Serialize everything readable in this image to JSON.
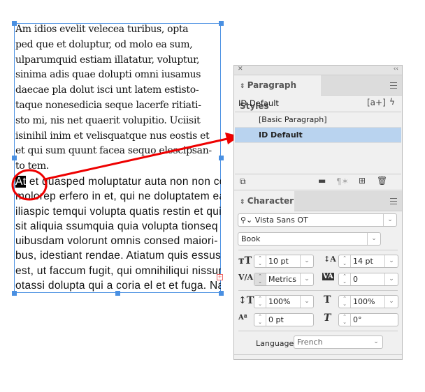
{
  "text_frame": {
    "serif_lines": [
      "Am idios evelit velecea turibus, opta",
      "ped que et doluptur, od molo ea sum,",
      "ulparumquid estiam illatatur, voluptur,",
      "sinima adis quae dolupti omni iusamus",
      "daecae pla dolut isci unt latem estisto-",
      "taque nonesedicia seque lacerfe ritiati-",
      "sto mi, nis net quaerit volupitio. Uciisit",
      "isinihil inim et velisquatque nus eostis et",
      "et qui sum quunt facea sequo elescipsan-",
      "to tem."
    ],
    "selected": "At",
    "sans_first_rest": " et quasped moluptatur auta non non con",
    "sans_lines": [
      "molorep erfero in et, qui ne doluptatem ea",
      "iliaspic temqui volupta quatis restin et qui-",
      "sit aliquia ssumquia quia volupta tionseq",
      "uibusdam volorunt omnis consed maiori-",
      "bus, idestiant rendae. Atiatum quis essus",
      "est, ut faccum fugit, qui omnihiliqui nissunt",
      "otassi dolupta qui a coria el et et fuga. Nam,"
    ]
  },
  "paragraph_styles": {
    "title": "Paragraph Styles",
    "current": "ID Default",
    "items": [
      "[Basic Paragraph]",
      "ID Default"
    ],
    "selected_index": 1
  },
  "character": {
    "title": "Character",
    "font_family": "Vista Sans OT",
    "font_style": "Book",
    "size": "10 pt",
    "leading": "14 pt",
    "kerning": "Metrics",
    "tracking": "0",
    "vertical_scale": "100%",
    "horizontal_scale": "100%",
    "baseline_shift": "0 pt",
    "skew": "0°",
    "language_label": "Language:",
    "language": "French"
  },
  "colors": {
    "annotation": "#ee0000",
    "selection": "#b9d3ef",
    "frame": "#4a90e2"
  }
}
